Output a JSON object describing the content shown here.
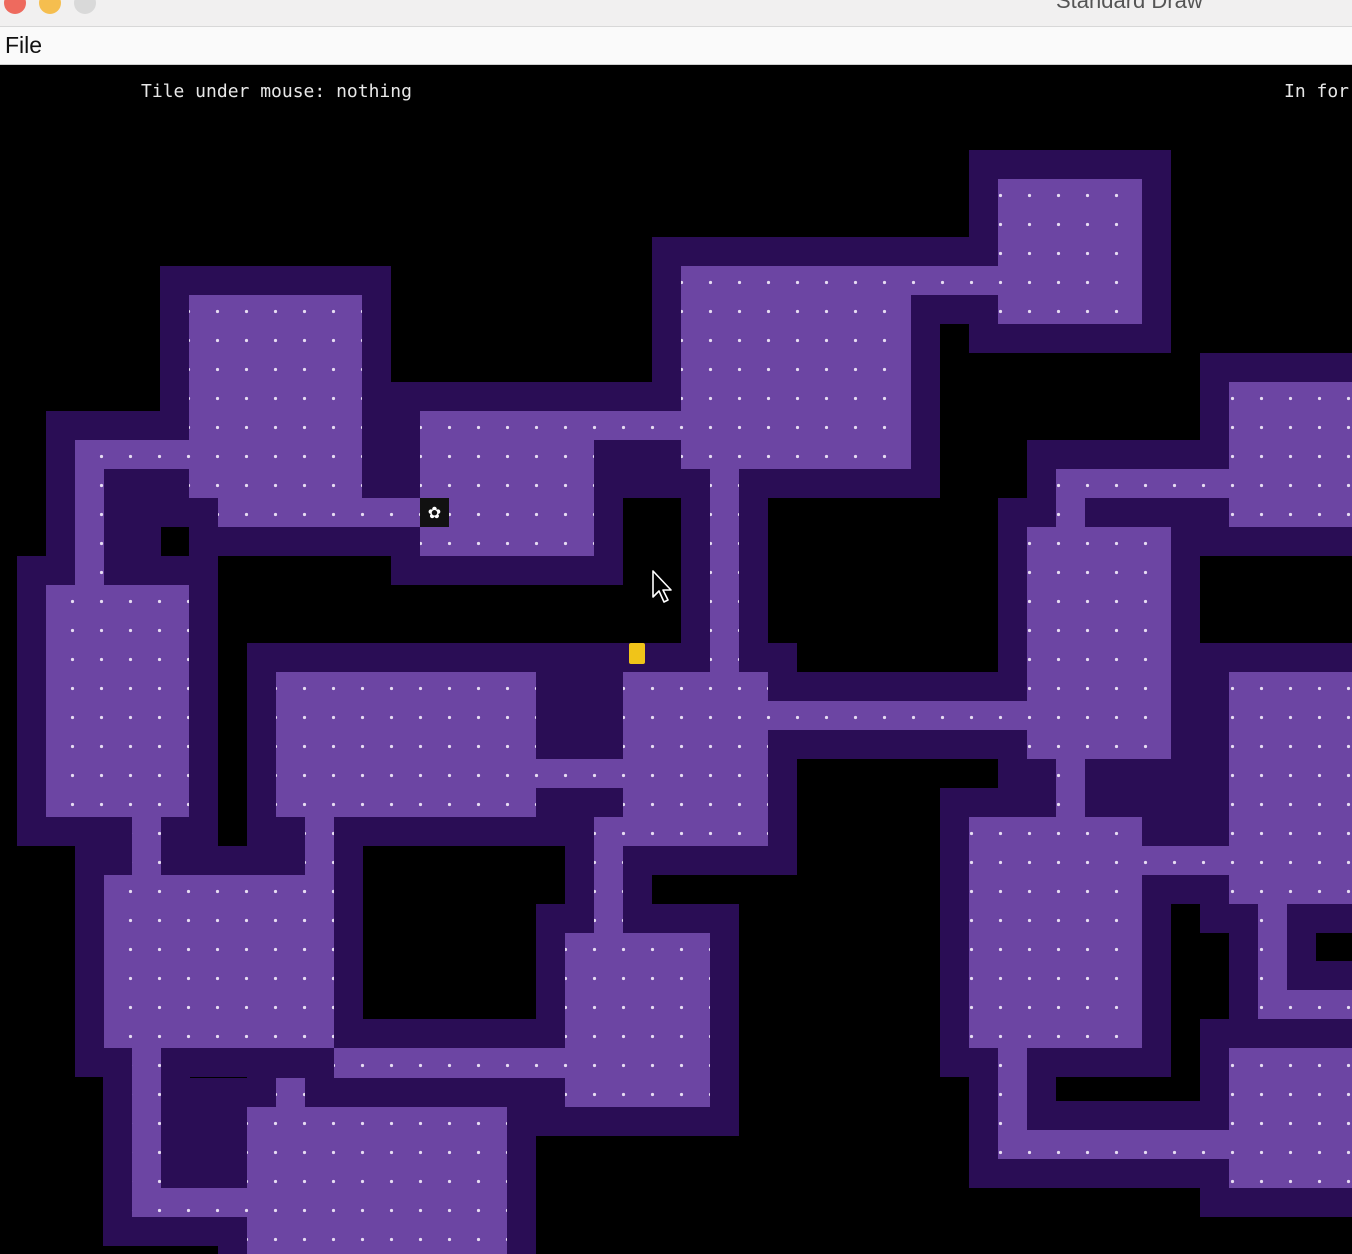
{
  "window": {
    "title": "Standard Draw"
  },
  "menu": {
    "file_label": "File"
  },
  "hud": {
    "tile_under_mouse": "Tile under mouse: nothing",
    "right_text": "In for"
  },
  "colors": {
    "background": "#000000",
    "wall": "#2a0d55",
    "floor": "#6c45a3",
    "floor_dot": "#e6dcf2",
    "avatar": "#f0c419",
    "flower_tile": "#111111",
    "flower_glyph": "#ffffff"
  },
  "tiles": {
    "wall_tile_name": "wall",
    "floor_tile_name": "floor",
    "avatar_name": "avatar",
    "flower_tile_name": "flower",
    "flower_glyph": "✿"
  }
}
